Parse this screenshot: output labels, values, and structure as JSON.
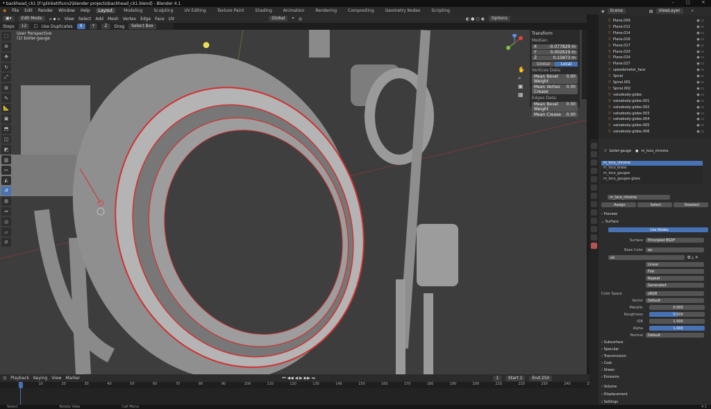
{
  "titlebar": {
    "title": "* backhead_ck1 [F:\\plinkettfunn2\\blender projects\\backhead_ck1.blend] - Blender 4.1"
  },
  "menubar": [
    "File",
    "Edit",
    "Render",
    "Window",
    "Help"
  ],
  "workspaces": [
    "Layout",
    "Modeling",
    "Sculpting",
    "UV Editing",
    "Texture Paint",
    "Shading",
    "Animation",
    "Rendering",
    "Compositing",
    "Geometry Nodes",
    "Scripting"
  ],
  "scene": {
    "name": "Scene",
    "view_layer": "ViewLayer"
  },
  "viewport_header": {
    "mode": "Edit Mode",
    "menus": [
      "View",
      "Select",
      "Add",
      "Mesh",
      "Vertex",
      "Edge",
      "Face",
      "UV"
    ],
    "orientation": "Global",
    "options": "Options"
  },
  "tool_options": {
    "steps_label": "Steps",
    "steps_value": "12",
    "use_duplicates": "Use Duplicates",
    "x": "X",
    "y": "Y",
    "z": "Z",
    "drag": "Drag",
    "select_box": "Select Box"
  },
  "viewport_info": {
    "line1": "User Perspective",
    "line2": "(1) boiler-gauge"
  },
  "transform_panel": {
    "title": "Transform",
    "median": "Median:",
    "x_label": "X",
    "x_value": "-0.077829 m",
    "y_label": "Y",
    "y_value": "0.002619 m",
    "z_label": "Z",
    "z_value": "0.15873 m",
    "global": "Global",
    "local": "Local",
    "vertex_data": "Vertices Data:",
    "mean_bevel_weight": "Mean Bevel Weight",
    "mean_bevel_weight_value": "0.00",
    "mean_vertex_crease": "Mean Vertex Crease",
    "mean_vertex_crease_value": "0.00",
    "edges_data": "Edges Data:",
    "edge_bevel": "Mean Bevel Weight",
    "edge_bevel_value": "0.00",
    "mean_crease": "Mean Crease",
    "mean_crease_value": "0.00"
  },
  "outliner": {
    "items": [
      "Plane.009",
      "Plane.012",
      "Plane.014",
      "Plane.016",
      "Plane.017",
      "Plane.020",
      "Plane.024",
      "Plane.027",
      "speedometer_face",
      "Spiral",
      "Spiral.001",
      "Spiral.002",
      "valvebody-globe",
      "valvebody-globe.001",
      "valvebody-globe.002",
      "valvebody-globe.003",
      "valvebody-globe.004",
      "valvebody-globe.005",
      "valvebody-globe.006"
    ]
  },
  "properties": {
    "breadcrumb_object": "boiler-gauge",
    "breadcrumb_material": "m_loco_chrome",
    "slots": [
      "m_loco_chrome",
      "m_loco_brass",
      "m_loco_gauges",
      "m_loco_gauges-glass"
    ],
    "material_name": "m_loco_chrome",
    "assign": "Assign",
    "select": "Select",
    "deselect": "Deselect",
    "preview": "Preview",
    "surface_section": "Surface",
    "use_nodes": "Use Nodes",
    "surface_label": "Surface",
    "surface_value": "Principled BSDF",
    "base_color_label": "Base Color",
    "base_color_value": "ao",
    "image_name": "ao",
    "interp": "Linear",
    "projection": "Flat",
    "extension": "Repeat",
    "source": "Generated",
    "color_space_label": "Color Space",
    "color_space_value": "sRGB",
    "vector_label": "Vector",
    "vector_value": "Default",
    "metallic_label": "Metallic",
    "metallic_value": "0.000",
    "roughness_label": "Roughness",
    "roughness_value": "0.500",
    "ior_label": "IOR",
    "ior_value": "1.500",
    "alpha_label": "Alpha",
    "alpha_value": "1.000",
    "normal_label": "Normal",
    "normal_value": "Default",
    "sections": [
      "Subsurface",
      "Specular",
      "Transmission",
      "Coat",
      "Sheen",
      "Emission"
    ],
    "volume": "Volume",
    "displacement": "Displacement",
    "settings": "Settings"
  },
  "timeline": {
    "playback": "Playback",
    "keying": "Keying",
    "view": "View",
    "marker": "Marker",
    "current_frame": "1",
    "start_label": "Start",
    "start": "1",
    "end_label": "End",
    "end": "250",
    "ruler": [
      "1",
      "10",
      "20",
      "30",
      "40",
      "50",
      "60",
      "70",
      "80",
      "90",
      "100",
      "110",
      "120",
      "130",
      "140",
      "150",
      "160",
      "170",
      "180",
      "190",
      "200",
      "210",
      "220",
      "230",
      "240",
      "250"
    ]
  },
  "statusbar": {
    "select": "Select",
    "rotate": "Rotate View",
    "call_menu": "Call Menu",
    "version": "4.1"
  },
  "colors": {
    "accent": "#4772b3",
    "selection": "#d03030",
    "viewport": "#3d3d3d"
  }
}
